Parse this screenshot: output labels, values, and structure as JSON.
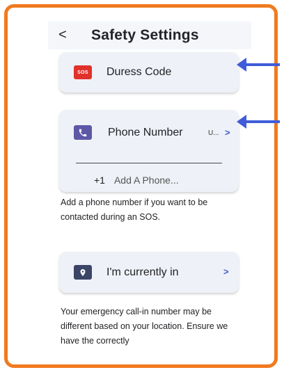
{
  "header": {
    "back_symbol": "<",
    "title": "Safety Settings"
  },
  "duress": {
    "badge": "SOS",
    "label": "Duress Code"
  },
  "phone": {
    "label": "Phone Number",
    "value": "U...",
    "chevron": ">",
    "country_code": "+1",
    "placeholder": "Add A Phone...",
    "help": "Add a phone number if you want to be contacted during an SOS."
  },
  "location": {
    "label": "I'm currently in",
    "chevron": ">",
    "help": "Your emergency call-in number may be different based on your location. Ensure we have the correctly"
  },
  "colors": {
    "frame_border": "#f07a1f",
    "card_background": "#eef1f7",
    "sos_badge": "#e0312b",
    "phone_icon_bg": "#5d58a6",
    "location_icon_bg": "#3b4566",
    "chevron_accent": "#3f5ccc",
    "annotation_arrow": "#3f5cd9"
  },
  "icons": {
    "back": "back-chevron-icon",
    "phone": "phone-icon",
    "location": "location-pin-icon",
    "chevron": "chevron-right-icon"
  }
}
